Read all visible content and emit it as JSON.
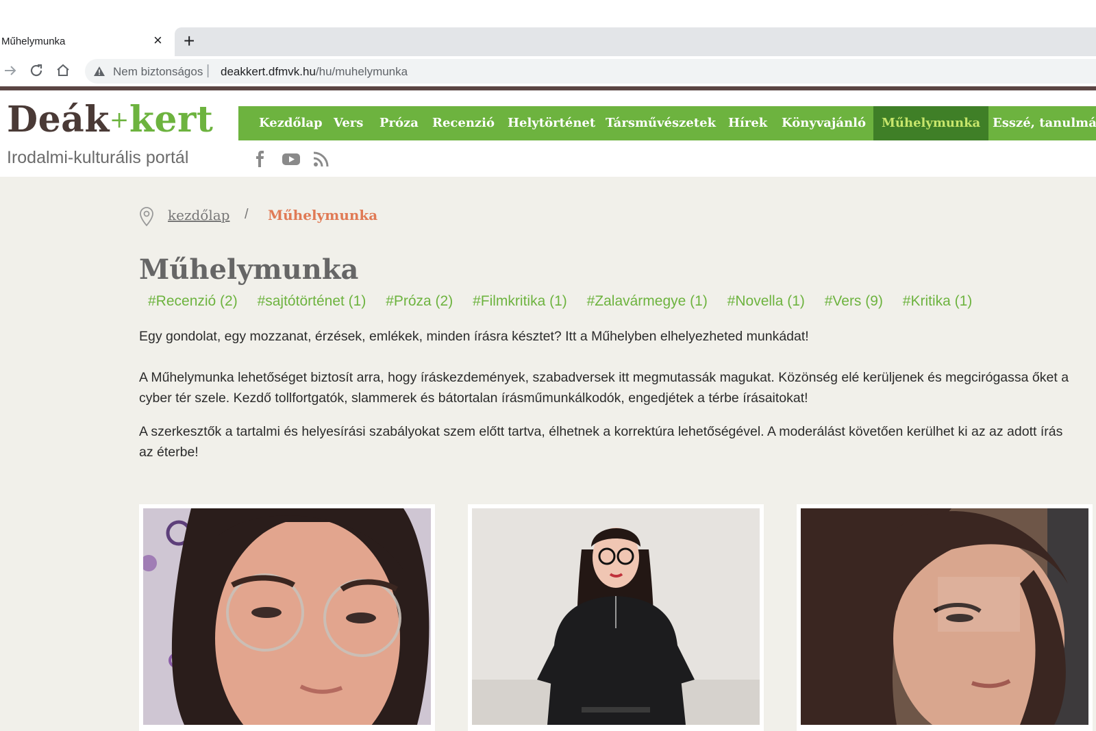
{
  "browser": {
    "tab_title": "Műhelymunka",
    "tab_close": "×",
    "new_tab": "+",
    "security_label": "Nem biztonságos",
    "url_separator": "|",
    "url_host": "deakkert.dfmvk.hu",
    "url_path": "/hu/muhelymunka"
  },
  "site": {
    "logo_part1": "Deák",
    "logo_plus": "+",
    "logo_part2": "kert",
    "tagline": "Irodalmi-kulturális portál",
    "social_icons": [
      "facebook-icon",
      "youtube-icon",
      "rss-icon"
    ],
    "nav": [
      {
        "label": "Kezdőlap"
      },
      {
        "label": "Vers"
      },
      {
        "label": "Próza"
      },
      {
        "label": "Recenzió"
      },
      {
        "label": "Helytörténet"
      },
      {
        "label": "Társművészetek"
      },
      {
        "label": "Hírek"
      },
      {
        "label": "Könyvajánló"
      },
      {
        "label": "Műhelymunka",
        "active": true
      },
      {
        "label": "Esszé, tanulmány"
      }
    ],
    "colors": {
      "brand_green": "#6db33f",
      "active_nav": "#3f7f27",
      "breadcrumb_current": "#e07a55"
    }
  },
  "breadcrumb": {
    "home": "kezdőlap",
    "separator": "/",
    "current": "Műhelymunka"
  },
  "page": {
    "title": "Műhelymunka",
    "tags": [
      "#Recenzió (2)",
      "#sajtótörténet (1)",
      "#Próza (2)",
      "#Filmkritika (1)",
      "#Zalavármegye (1)",
      "#Novella (1)",
      "#Vers (9)",
      "#Kritika (1)"
    ],
    "intro": "Egy gondolat, egy mozzanat, érzések, emlékek, minden írásra késztet? Itt a Műhelyben elhelyezheted munkádat!",
    "para1_line1": "A Műhelymunka lehetőséget biztosít arra, hogy íráskezdemények, szabadversek itt megmutassák magukat. Közönség elé kerüljenek és megcirógassa őket a",
    "para1_line2": "cyber tér szele. Kezdő tollfortgatók, slammerek és bátortalan írásműmunkálkodók, engedjétek a térbe írásaitokat!",
    "para2_line1": "A szerkesztők a tartalmi és helyesírási szabályokat szem előtt tartva, élhetnek a korrektúra lehetőségével. A moderálást követően kerülhet ki az az adott írás",
    "para2_line2": "az éterbe!"
  },
  "cards": [
    {
      "image": "portrait-glasses-photo"
    },
    {
      "image": "portrait-standing-photo"
    },
    {
      "image": "portrait-soft-light-photo"
    }
  ]
}
